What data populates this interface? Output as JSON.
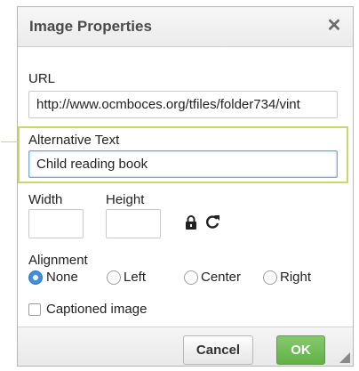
{
  "dialog": {
    "title": "Image Properties",
    "close_glyph": "✕"
  },
  "url": {
    "label": "URL",
    "value": "http://www.ocmboces.org/tfiles/folder734/vint"
  },
  "alt_text": {
    "label": "Alternative Text",
    "value": "Child reading book"
  },
  "width": {
    "label": "Width",
    "value": ""
  },
  "height": {
    "label": "Height",
    "value": ""
  },
  "icons": {
    "lock": "lock-icon",
    "reset": "reset-size-icon"
  },
  "alignment": {
    "label": "Alignment",
    "options": [
      "None",
      "Left",
      "Center",
      "Right"
    ],
    "selected": "None"
  },
  "captioned": {
    "label": "Captioned image",
    "checked": false
  },
  "footer": {
    "cancel_label": "Cancel",
    "ok_label": "OK"
  },
  "colors": {
    "highlight": "#c8d96b",
    "ok_button": "#5fb246",
    "radio_selected": "#3f8fd9",
    "focus_border": "#7aa6d8"
  }
}
